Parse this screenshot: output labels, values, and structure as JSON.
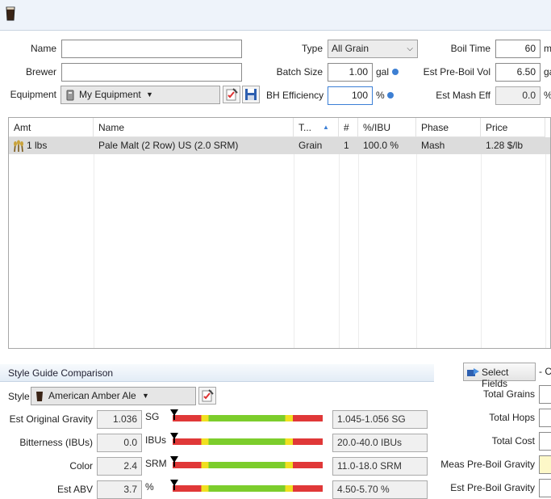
{
  "header": {
    "name_label": "Name",
    "brewer_label": "Brewer",
    "equipment_label": "Equipment",
    "equipment_value": "My Equipment",
    "name_value": "",
    "brewer_value": "",
    "type_label": "Type",
    "type_value": "All Grain",
    "batch_size_label": "Batch Size",
    "batch_size_value": "1.00",
    "batch_size_unit": "gal",
    "bh_eff_label": "BH Efficiency",
    "bh_eff_value": "100",
    "bh_eff_unit": "%",
    "boil_time_label": "Boil Time",
    "boil_time_value": "60",
    "boil_time_unit": "m",
    "pre_boil_label": "Est Pre-Boil Vol",
    "pre_boil_value": "6.50",
    "pre_boil_unit": "ga",
    "mash_eff_label": "Est Mash Eff",
    "mash_eff_value": "0.0",
    "mash_eff_unit": "%"
  },
  "table": {
    "columns": [
      "Amt",
      "Name",
      "T...",
      "#",
      "%/IBU",
      "Phase",
      "Price"
    ],
    "rows": [
      {
        "amt": "1 lbs",
        "name": "Pale Malt (2 Row) US (2.0 SRM)",
        "type": "Grain",
        "num": "1",
        "pct": "100.0 %",
        "phase": "Mash",
        "price": "1.28 $/lb"
      }
    ]
  },
  "style": {
    "section_title": "Style Guide Comparison",
    "style_label": "Style",
    "style_value": "American Amber Ale",
    "select_fields_label": "Select Fields",
    "select_fields_extra": "- C",
    "rows": [
      {
        "label": "Est Original Gravity",
        "value": "1.036",
        "unit": "SG",
        "range": "1.045-1.056 SG",
        "level": 0.0
      },
      {
        "label": "Bitterness (IBUs)",
        "value": "0.0",
        "unit": "IBUs",
        "range": "20.0-40.0 IBUs",
        "level": 0.0
      },
      {
        "label": "Color",
        "value": "2.4",
        "unit": "SRM",
        "range": "11.0-18.0 SRM",
        "level": 0.0
      },
      {
        "label": "Est ABV",
        "value": "3.7",
        "unit": "%",
        "range": "4.50-5.70 %",
        "level": 0.0
      }
    ],
    "right_labels": [
      "Total Grains",
      "Total Hops",
      "Total Cost",
      "Meas Pre-Boil Gravity",
      "Est Pre-Boil Gravity"
    ]
  },
  "colors": {
    "accent": "#3d7fd3",
    "row_selected": "#dcdcdc",
    "bar_red": "#e03838",
    "bar_yellow": "#f0e020",
    "bar_green": "#7ccd2c"
  }
}
